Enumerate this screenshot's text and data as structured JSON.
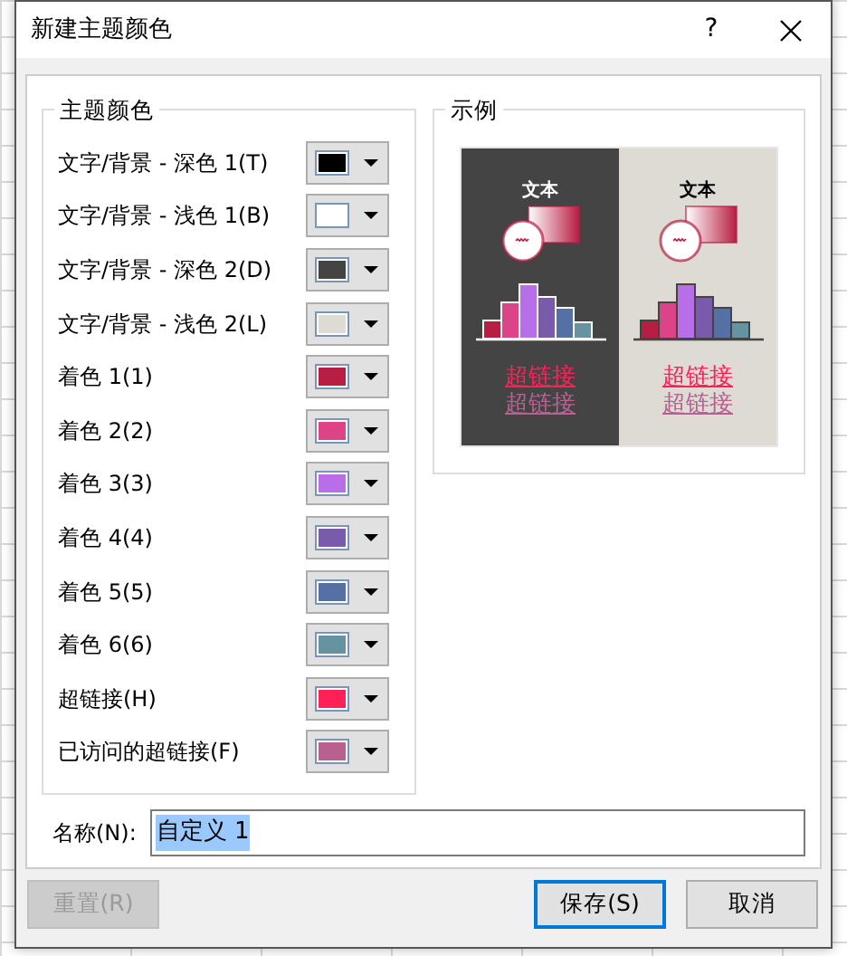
{
  "window": {
    "title": "新建主题颜色",
    "help": "?"
  },
  "theme_colors": {
    "legend": "主题颜色",
    "items": [
      {
        "label": "文字/背景 - 深色 1(T)",
        "color": "#000000"
      },
      {
        "label": "文字/背景 - 浅色 1(B)",
        "color": "#ffffff"
      },
      {
        "label": "文字/背景 - 深色 2(D)",
        "color": "#444444"
      },
      {
        "label": "文字/背景 - 浅色 2(L)",
        "color": "#dedbd5"
      },
      {
        "label": "着色 1(1)",
        "color": "#b81d42"
      },
      {
        "label": "着色 2(2)",
        "color": "#dd4488"
      },
      {
        "label": "着色 3(3)",
        "color": "#b86ee8"
      },
      {
        "label": "着色 4(4)",
        "color": "#7a5aaa"
      },
      {
        "label": "着色 5(5)",
        "color": "#5570a5"
      },
      {
        "label": "着色 6(6)",
        "color": "#6693a0"
      },
      {
        "label": "超链接(H)",
        "color": "#ff2058"
      },
      {
        "label": "已访问的超链接(F)",
        "color": "#b86090"
      }
    ]
  },
  "sample": {
    "legend": "示例",
    "panels": [
      {
        "text": "文本",
        "link": "超链接",
        "visited_link": "超链接"
      },
      {
        "text": "文本",
        "link": "超链接",
        "visited_link": "超链接"
      }
    ]
  },
  "name": {
    "label": "名称(N):",
    "value": "自定义 1",
    "text_selected": true
  },
  "buttons": [
    {
      "label": "重置(R)",
      "disabled": true,
      "default": false
    },
    {
      "label": "保存(S)",
      "disabled": false,
      "default": true
    },
    {
      "label": "取消",
      "disabled": false,
      "default": false
    }
  ]
}
